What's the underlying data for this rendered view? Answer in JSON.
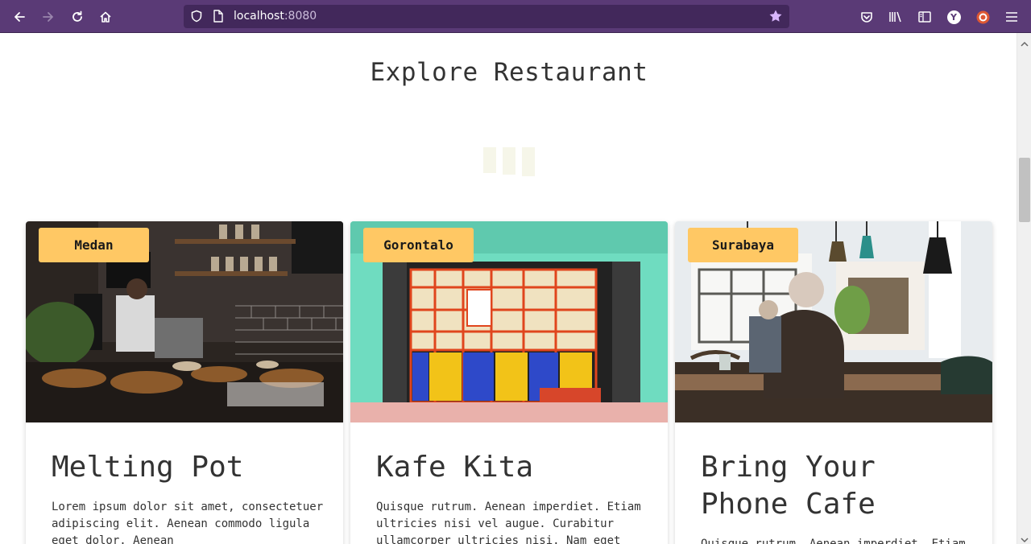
{
  "browser": {
    "url_host": "localhost",
    "url_port": ":8080",
    "icons": [
      "back-arrow-icon",
      "forward-arrow-icon",
      "reload-icon",
      "home-icon",
      "shield-icon",
      "page-icon",
      "bookmark-star-icon",
      "pocket-icon",
      "library-icon",
      "sidebar-icon",
      "yandex-icon",
      "duckduckgo-icon",
      "menu-icon"
    ],
    "yandex_letter": "Y"
  },
  "page": {
    "title": "Explore Restaurant"
  },
  "colors": {
    "toolbar": "#5a3a76",
    "urlbar": "#42285b",
    "badge": "#ffc864",
    "loader": "#f6f6e9"
  },
  "restaurants": [
    {
      "city": "Medan",
      "name": "Melting Pot",
      "description": "Lorem ipsum dolor sit amet, consectetuer adipiscing elit. Aenean commodo ligula eget dolor. Aenean"
    },
    {
      "city": "Gorontalo",
      "name": "Kafe Kita",
      "description": "Quisque rutrum. Aenean imperdiet. Etiam ultricies nisi vel augue. Curabitur ullamcorper ultricies nisi. Nam eget"
    },
    {
      "city": "Surabaya",
      "name": "Bring Your Phone Cafe",
      "description": "Quisque rutrum. Aenean imperdiet. Etiam"
    }
  ]
}
